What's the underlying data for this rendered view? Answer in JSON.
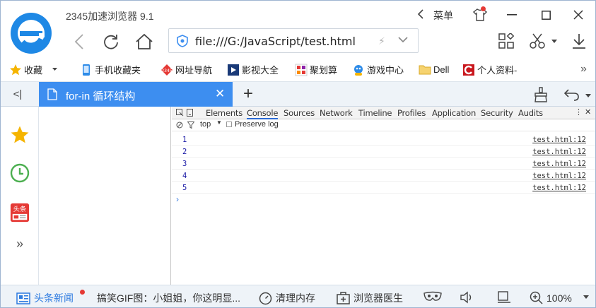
{
  "window": {
    "title": "2345加速浏览器 9.1",
    "menu_label": "菜单"
  },
  "address_bar": {
    "url": "file:///G:/JavaScript/test.html"
  },
  "bookmarks": [
    {
      "label": "收藏",
      "icon": "star-icon"
    },
    {
      "label": "手机收藏夹",
      "icon": "phone-icon"
    },
    {
      "label": "网址导航",
      "icon": "2345-icon"
    },
    {
      "label": "影视大全",
      "icon": "film-icon"
    },
    {
      "label": "聚划算",
      "icon": "juhuasuan-icon"
    },
    {
      "label": "游戏中心",
      "icon": "game-icon"
    },
    {
      "label": "Dell",
      "icon": "folder-icon"
    },
    {
      "label": "个人资料-",
      "icon": "c-logo-icon"
    }
  ],
  "tabs": [
    {
      "label": "for-in 循环结构",
      "active": true
    }
  ],
  "devtools": {
    "tabs": [
      "Elements",
      "Console",
      "Sources",
      "Network",
      "Timeline",
      "Profiles",
      "Application",
      "Security",
      "Audits"
    ],
    "active_tab": "Console",
    "context": "top",
    "preserve_log": "Preserve log",
    "console_rows": [
      {
        "value": "1",
        "source": "test.html:12"
      },
      {
        "value": "2",
        "source": "test.html:12"
      },
      {
        "value": "3",
        "source": "test.html:12"
      },
      {
        "value": "4",
        "source": "test.html:12"
      },
      {
        "value": "5",
        "source": "test.html:12"
      }
    ],
    "prompt": "›"
  },
  "status_bar": {
    "news": "头条新闻",
    "headline": "搞笑GIF图：小姐姐，你这明显...",
    "clean_memory": "清理内存",
    "doctor": "浏览器医生",
    "zoom": "100%"
  },
  "colors": {
    "accent": "#3d8ef0",
    "logo_blue": "#1e88e5",
    "console_value": "#1a1aa6"
  }
}
